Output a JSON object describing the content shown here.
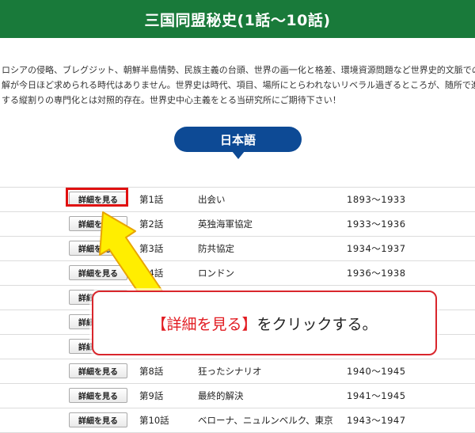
{
  "header": {
    "title": "三国同盟秘史(1話〜10話)"
  },
  "intro": {
    "lines": [
      "ロシアの侵略、ブレグジット、朝鮮半島情勢、民族主義の台頭、世界の画一化と格差、環境資源問題など世界史的文脈での理",
      "解が今日ほど求められる時代はありません。世界史は時代、項目、場所にとらわれないリベラル過ぎるところが、随所で進行",
      "する縦割りの専門化とは対照的存在。世界史中心主義をとる当研究所にご期待下さい！"
    ]
  },
  "language_badge": {
    "label": "日本語"
  },
  "button_label": "詳細を見る",
  "episodes": [
    {
      "ep": "第1話",
      "title": "出会い",
      "years": "1893〜1933"
    },
    {
      "ep": "第2話",
      "title": "英独海軍協定",
      "years": "1933〜1936"
    },
    {
      "ep": "第3話",
      "title": "防共協定",
      "years": "1934〜1937"
    },
    {
      "ep": "第4話",
      "title": "ロンドン",
      "years": "1936〜1938"
    },
    {
      "ep": "",
      "title": "",
      "years": ""
    },
    {
      "ep": "",
      "title": "",
      "years": ""
    },
    {
      "ep": "",
      "title": "",
      "years": ""
    },
    {
      "ep": "第8話",
      "title": "狂ったシナリオ",
      "years": "1940〜1945"
    },
    {
      "ep": "第9話",
      "title": "最終的解決",
      "years": "1941〜1945"
    },
    {
      "ep": "第10話",
      "title": "ベローナ、ニュルンベルク、東京",
      "years": "1943〜1947"
    }
  ],
  "callout": {
    "highlight": "【詳細を見る】",
    "text": "をクリックする。"
  },
  "colors": {
    "header_bg": "#197a3a",
    "badge_bg": "#0d4a95",
    "highlight_red": "#e01010",
    "arrow_yellow": "#ffee00"
  }
}
